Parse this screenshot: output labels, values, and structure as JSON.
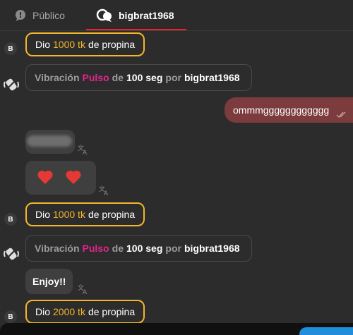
{
  "tabs": {
    "public_label": "Público",
    "user_label": "bigbrat1968"
  },
  "messages": {
    "tip1": {
      "avatar": "B",
      "prefix": "Dio",
      "amount": "1000 tk",
      "suffix": "de propina"
    },
    "vib1": {
      "prefix": "Vibración",
      "type": "Pulso",
      "mid": "de",
      "duration": "100 seg",
      "by": "por",
      "user": "bigbrat1968"
    },
    "outgoing": {
      "text": "ommmgggggggggggg"
    },
    "tip2": {
      "avatar": "B",
      "prefix": "Dio",
      "amount": "1000 tk",
      "suffix": "de propina"
    },
    "vib2": {
      "prefix": "Vibración",
      "type": "Pulso",
      "mid": "de",
      "duration": "100 seg",
      "by": "por",
      "user": "bigbrat1968"
    },
    "enjoy": {
      "text": "Enjoy!!"
    },
    "tip3": {
      "avatar": "B",
      "prefix": "Dio",
      "amount": "2000 tk",
      "suffix": "de propina"
    }
  },
  "colors": {
    "tip_border": "#f4b62a",
    "pulse_pink": "#e5238f",
    "tab_active": "#e8242f",
    "outgoing_bubble": "#7c3b3d"
  },
  "icons": {
    "public_tab": "chat-bubble-icon",
    "user_tab": "private-chat-icon",
    "vibration": "vibration-icon",
    "translate": "translate-icon",
    "heart": "heart-icon",
    "read_receipt": "double-check-icon"
  }
}
